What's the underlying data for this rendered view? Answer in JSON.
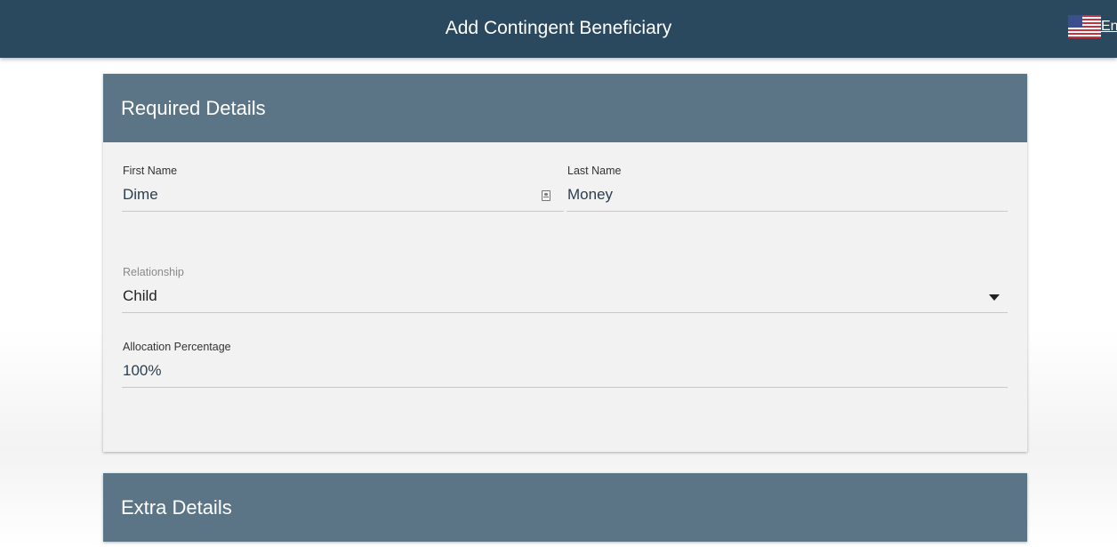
{
  "header": {
    "title": "Add Contingent Beneficiary",
    "language_label": "En",
    "language_icon": "us-flag-icon"
  },
  "required_details": {
    "title": "Required Details",
    "first_name": {
      "label": "First Name",
      "value": "Dime",
      "icon": "contact-card-icon"
    },
    "last_name": {
      "label": "Last Name",
      "value": "Money"
    },
    "relationship": {
      "label": "Relationship",
      "value": "Child",
      "icon": "caret-down-icon"
    },
    "allocation": {
      "label": "Allocation Percentage",
      "value": "100%"
    }
  },
  "extra_details": {
    "title": "Extra Details"
  },
  "colors": {
    "topbar": "#2a485e",
    "section_header": "#5b7586",
    "card_body": "#f2f2f2",
    "value_text": "#2b3e50"
  }
}
